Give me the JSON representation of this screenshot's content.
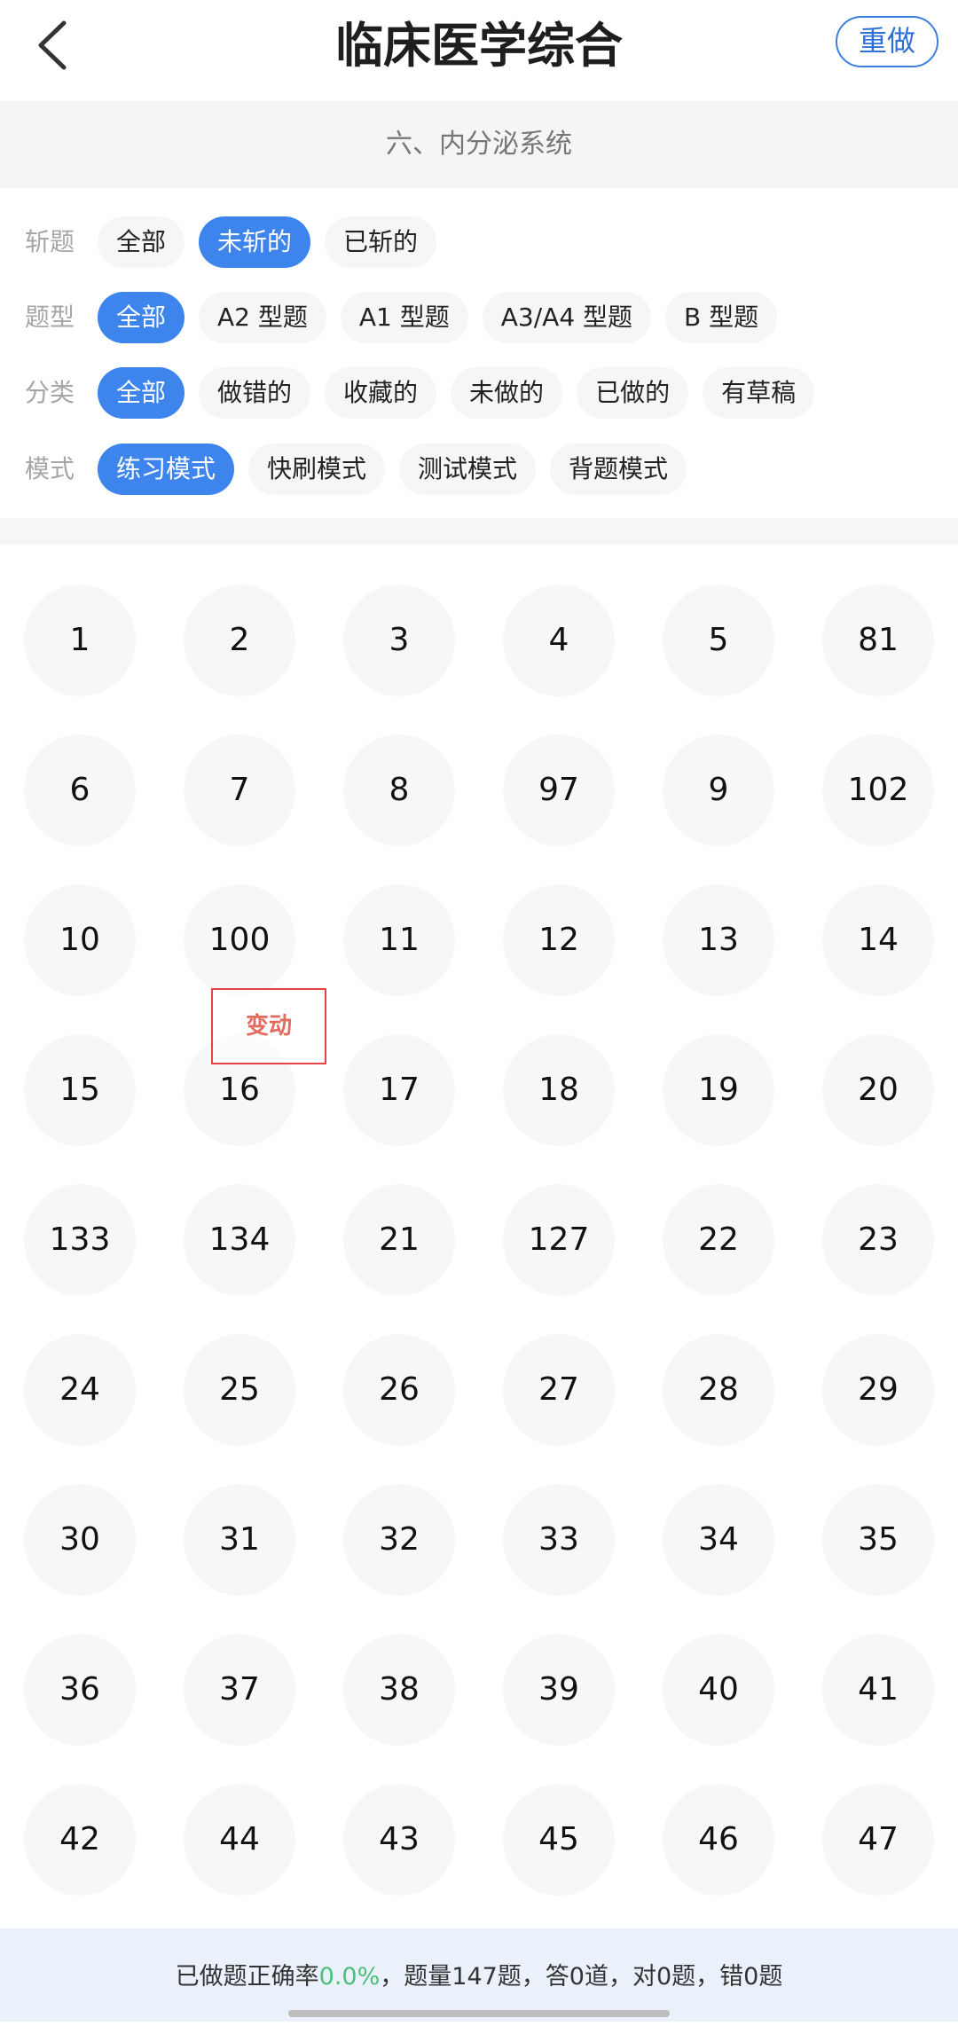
{
  "header": {
    "title": "临床医学综合",
    "redo_label": "重做"
  },
  "section": {
    "name": "六、内分泌系统"
  },
  "filters": [
    {
      "label": "斩题",
      "options": [
        "全部",
        "未斩的",
        "已斩的"
      ],
      "active": 1
    },
    {
      "label": "题型",
      "options": [
        "全部",
        "A2 型题",
        "A1 型题",
        "A3/A4 型题",
        "B 型题"
      ],
      "active": 0
    },
    {
      "label": "分类",
      "options": [
        "全部",
        "做错的",
        "收藏的",
        "未做的",
        "已做的",
        "有草稿"
      ],
      "active": 0
    },
    {
      "label": "模式",
      "options": [
        "练习模式",
        "快刷模式",
        "测试模式",
        "背题模式"
      ],
      "active": 0
    }
  ],
  "questions": [
    "1",
    "2",
    "3",
    "4",
    "5",
    "81",
    "6",
    "7",
    "8",
    "97",
    "9",
    "102",
    "10",
    "100",
    "11",
    "12",
    "13",
    "14",
    "15",
    "16",
    "17",
    "18",
    "19",
    "20",
    "133",
    "134",
    "21",
    "127",
    "22",
    "23",
    "24",
    "25",
    "26",
    "27",
    "28",
    "29",
    "30",
    "31",
    "32",
    "33",
    "34",
    "35",
    "36",
    "37",
    "38",
    "39",
    "40",
    "41",
    "42",
    "44",
    "43",
    "45",
    "46",
    "47"
  ],
  "change_tag": "变动",
  "footer": {
    "prefix": "已做题正确率",
    "rate": "0.0%",
    "suffix": "，题量147题，答0道，对0题，错0题"
  },
  "colors": {
    "accent": "#3d84ec",
    "rate_green": "#4cc07a",
    "change_red": "#e24343"
  }
}
